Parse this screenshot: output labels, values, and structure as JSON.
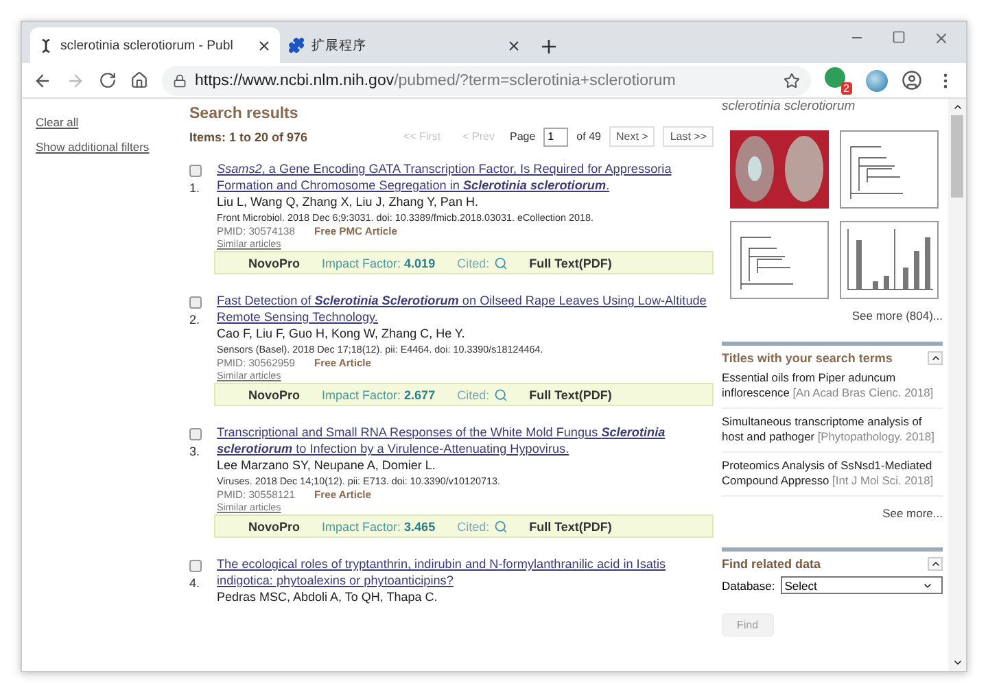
{
  "browser": {
    "tabs": [
      {
        "title": "sclerotinia sclerotiorum - Publ",
        "selected": true
      },
      {
        "title": "扩展程序",
        "selected": false
      }
    ],
    "url_host": "https://www.ncbi.nlm.nih.gov",
    "url_path": "/pubmed/?term=sclerotinia+sclerotiorum",
    "extension_badge": "2"
  },
  "sidebar": {
    "links": [
      "Clear all",
      "Show additional filters"
    ]
  },
  "results": {
    "heading": "Search results",
    "count": "Items: 1 to 20 of 976",
    "pager": {
      "buttons_before": [
        {
          "label": "<< First",
          "disabled": true
        },
        {
          "label": "< Prev",
          "disabled": true
        }
      ],
      "page_label": "Page",
      "page": "1",
      "of": "of 49",
      "buttons_after": [
        {
          "label": "Next >",
          "disabled": false
        },
        {
          "label": "Last >>",
          "disabled": false
        }
      ]
    },
    "items": [
      {
        "checked": false,
        "number": "1.",
        "title": "*Ssams2*, a Gene Encoding GATA Transcription Factor, Is Required for Appressoria Formation and Chromosome Segregation in **Sclerotinia sclerotiorum**.",
        "authors": "Liu L, Wang Q, Zhang X, Liu J, Zhang Y, Pan H.",
        "citation": "Front Microbiol. 2018 Dec 6;9:3031. doi: 10.3389/fmicb.2018.03031. eCollection 2018.",
        "pmid": "PMID: 30574138",
        "access": "Free PMC Article",
        "similar": "Similar articles",
        "novopro": {
          "brand": "NovoPro",
          "if_label": "Impact Factor:",
          "if_value": "4.019",
          "cited": "Cited:",
          "fulltext": "Full Text(PDF)"
        }
      },
      {
        "checked": false,
        "number": "2.",
        "title": "Fast Detection of **Sclerotinia Sclerotiorum** on Oilseed Rape Leaves Using Low-Altitude Remote Sensing Technology.",
        "authors": "Cao F, Liu F, Guo H, Kong W, Zhang C, He Y.",
        "citation": "Sensors (Basel). 2018 Dec 17;18(12). pii: E4464. doi: 10.3390/s18124464.",
        "pmid": "PMID: 30562959",
        "access": "Free Article",
        "similar": "Similar articles",
        "novopro": {
          "brand": "NovoPro",
          "if_label": "Impact Factor:",
          "if_value": "2.677",
          "cited": "Cited:",
          "fulltext": "Full Text(PDF)"
        }
      },
      {
        "checked": false,
        "number": "3.",
        "title": "Transcriptional and Small RNA Responses of the White Mold Fungus **Sclerotinia sclerotiorum** to Infection by a Virulence-Attenuating Hypovirus.",
        "authors": "Lee Marzano SY, Neupane A, Domier L.",
        "citation": "Viruses. 2018 Dec 14;10(12). pii: E713. doi: 10.3390/v10120713.",
        "pmid": "PMID: 30558121",
        "access": "Free Article",
        "similar": "Similar articles",
        "novopro": {
          "brand": "NovoPro",
          "if_label": "Impact Factor:",
          "if_value": "3.465",
          "cited": "Cited:",
          "fulltext": "Full Text(PDF)"
        }
      },
      {
        "checked": false,
        "number": "4.",
        "title": "The ecological roles of tryptanthrin, indirubin and N-formylanthranilic acid in Isatis indigotica: phytoalexins or phytoanticipins?",
        "authors": "Pedras MSC, Abdoli A, To QH, Thapa C."
      }
    ]
  },
  "images": {
    "caption": "sclerotinia sclerotiorum",
    "thumbnails": [
      {
        "kind": "photo"
      },
      {
        "kind": "tree"
      },
      {
        "kind": "tree"
      },
      {
        "kind": "chart"
      }
    ],
    "see_more": "See more (804)..."
  },
  "titles_panel": {
    "heading": "Titles with your search terms",
    "items": [
      {
        "title": "Essential oils from Piper aduncum inflorescence",
        "source": "[An Acad Bras Cienc. 2018]"
      },
      {
        "title": "Simultaneous transcriptome analysis of host and pathoger",
        "source": "[Phytopathology. 2018]"
      },
      {
        "title": "Proteomics Analysis of SsNsd1-Mediated Compound Appresso",
        "source": "[Int J Mol Sci. 2018]"
      }
    ],
    "see_more": "See more..."
  },
  "related_panel": {
    "heading": "Find related data",
    "db_label": "Database:",
    "db_value": "Select",
    "button": "Find"
  }
}
